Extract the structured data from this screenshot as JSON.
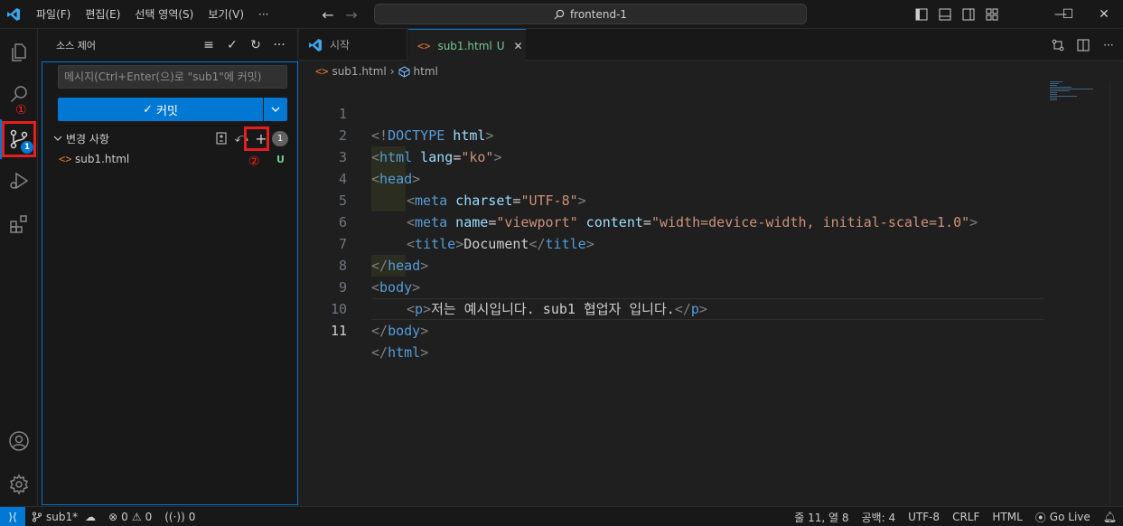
{
  "titlebar": {
    "menus": [
      "파일(F)",
      "편집(E)",
      "선택 영역(S)",
      "보기(V)",
      "···"
    ],
    "search": "frontend-1",
    "window_controls": {
      "minimize": "—",
      "maximize": "☐",
      "close": "✕"
    }
  },
  "annotations": {
    "one": "①",
    "two": "②"
  },
  "activity": {
    "scm_badge": "1"
  },
  "sidebar": {
    "title": "소스 제어",
    "commit_placeholder": "메시지(Ctrl+Enter(으)로 \"sub1\"에 커밋)",
    "commit_button": "커밋",
    "changes_label": "변경 사항",
    "changes_count": "1",
    "files": [
      {
        "name": "sub1.html",
        "status": "U"
      }
    ]
  },
  "tabs": [
    {
      "label": "시작"
    },
    {
      "label": "sub1.html",
      "status": "U"
    }
  ],
  "breadcrumb": {
    "file": "sub1.html",
    "symbol": "html"
  },
  "editor": {
    "line_numbers": [
      "1",
      "2",
      "3",
      "4",
      "5",
      "6",
      "7",
      "8",
      "9",
      "10",
      "11"
    ],
    "line1": {
      "a": "<!",
      "b": "DOCTYPE",
      "c": " html",
      "d": ">"
    },
    "line2": {
      "a": "<",
      "b": "html",
      "c": " lang",
      "d": "=",
      "e": "\"ko\"",
      "f": ">"
    },
    "line3": {
      "a": "<",
      "b": "head",
      "c": ">"
    },
    "line4": {
      "a": "<",
      "b": "meta",
      "c": " charset",
      "d": "=",
      "e": "\"UTF-8\"",
      "f": ">"
    },
    "line5": {
      "a": "<",
      "b": "meta",
      "c": " name",
      "d": "=",
      "e": "\"viewport\"",
      "f": " content",
      "g": "=",
      "h": "\"width=device-width, initial-scale=1.0\"",
      "i": ">"
    },
    "line6": {
      "a": "<",
      "b": "title",
      "c": ">",
      "d": "Document",
      "e": "</",
      "f": "title",
      "g": ">"
    },
    "line7": {
      "a": "</",
      "b": "head",
      "c": ">"
    },
    "line8": {
      "a": "<",
      "b": "body",
      "c": ">"
    },
    "line9": {
      "a": "<",
      "b": "p",
      "c": ">",
      "d": "저는 예시입니다. sub1 협업자 입니다.",
      "e": "</",
      "f": "p",
      "g": ">"
    },
    "line10": {
      "a": "</",
      "b": "body",
      "c": ">"
    },
    "line11": {
      "a": "</",
      "b": "html",
      "c": ">"
    }
  },
  "statusbar": {
    "branch": "sub1*",
    "errors": "0",
    "warnings": "0",
    "ports": "0",
    "position": "줄 11, 열 8",
    "spaces": "공백: 4",
    "encoding": "UTF-8",
    "eol": "CRLF",
    "language": "HTML",
    "golive": "Go Live"
  },
  "colors": {
    "accent": "#0078d4",
    "highlight": "#e51e1e"
  }
}
